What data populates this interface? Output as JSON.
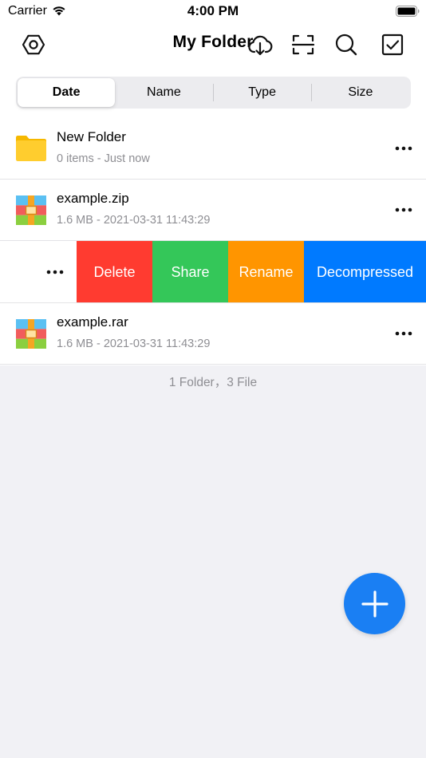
{
  "status_bar": {
    "carrier": "Carrier",
    "time": "4:00 PM"
  },
  "nav": {
    "title": "My Folder",
    "icons": [
      "settings-icon",
      "cloud-download-icon",
      "scan-icon",
      "search-icon",
      "select-checkbox-icon"
    ]
  },
  "segments": {
    "items": [
      "Date",
      "Name",
      "Type",
      "Size"
    ],
    "selected": "Date"
  },
  "files": [
    {
      "name": "New Folder",
      "detail": "0 items - Just now",
      "icon": "folder-icon"
    },
    {
      "name": "example.zip",
      "detail": "1.6 MB - 2021-03-31 11:43:29",
      "icon": "archive-icon"
    },
    {
      "name": "example.rar",
      "detail": "1.6 MB - 2021-03-31 11:43:29",
      "icon": "archive-icon"
    }
  ],
  "swipe_actions": {
    "delete": "Delete",
    "share": "Share",
    "rename": "Rename",
    "decompress": "Decompressed"
  },
  "colors": {
    "delete": "#ff3b30",
    "share": "#34c759",
    "rename": "#ff9500",
    "decompress": "#007aff",
    "fab": "#1a7ff3",
    "folder": "#ffcd2e"
  },
  "footer": {
    "count": "1 Folder，3 File"
  }
}
